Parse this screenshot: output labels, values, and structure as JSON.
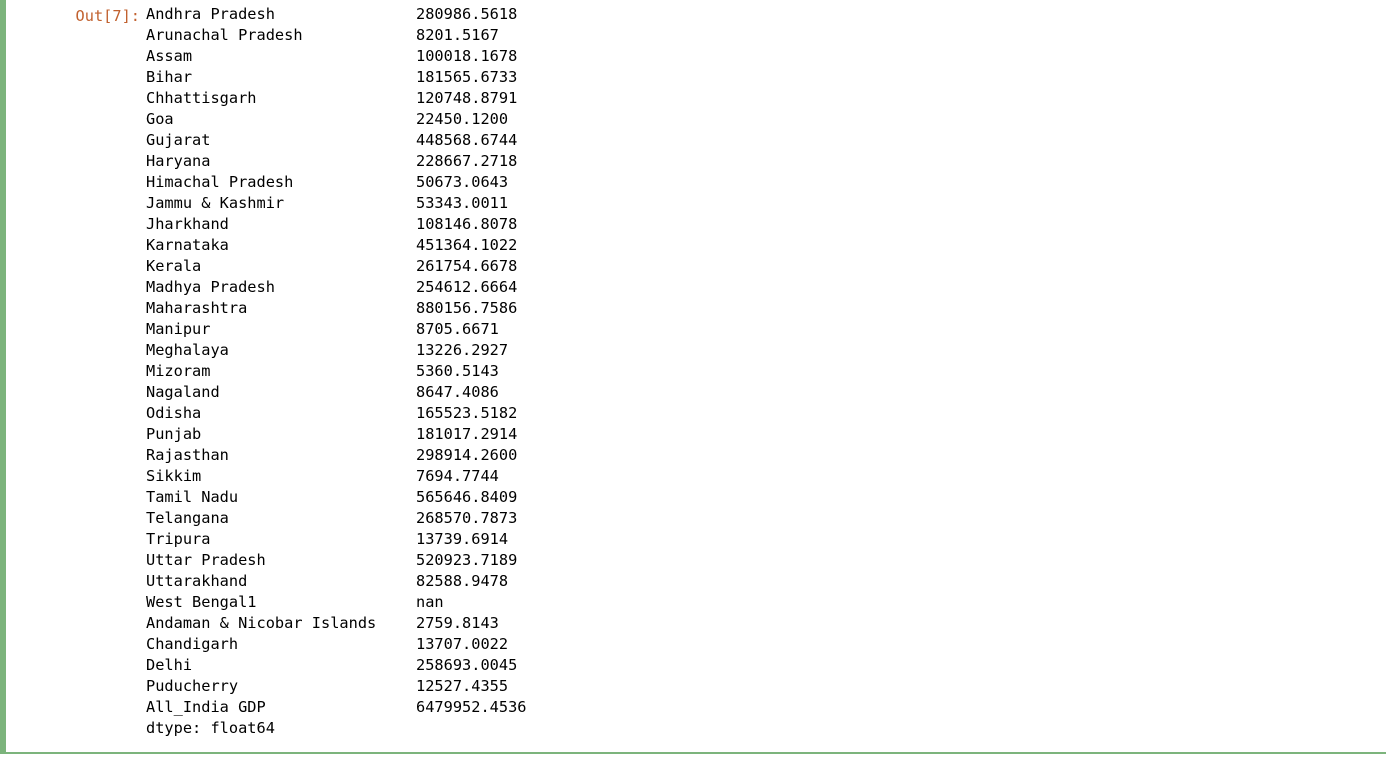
{
  "prompt": "Out[7]:",
  "rows": [
    {
      "name": "Andhra Pradesh",
      "value": "280986.5618"
    },
    {
      "name": "Arunachal Pradesh",
      "value": "8201.5167"
    },
    {
      "name": "Assam",
      "value": "100018.1678"
    },
    {
      "name": "Bihar",
      "value": "181565.6733"
    },
    {
      "name": "Chhattisgarh",
      "value": "120748.8791"
    },
    {
      "name": "Goa",
      "value": "22450.1200"
    },
    {
      "name": "Gujarat",
      "value": "448568.6744"
    },
    {
      "name": "Haryana",
      "value": "228667.2718"
    },
    {
      "name": "Himachal Pradesh",
      "value": "50673.0643"
    },
    {
      "name": "Jammu & Kashmir",
      "value": "53343.0011"
    },
    {
      "name": "Jharkhand",
      "value": "108146.8078"
    },
    {
      "name": "Karnataka",
      "value": "451364.1022"
    },
    {
      "name": "Kerala",
      "value": "261754.6678"
    },
    {
      "name": "Madhya Pradesh",
      "value": "254612.6664"
    },
    {
      "name": "Maharashtra",
      "value": "880156.7586"
    },
    {
      "name": "Manipur",
      "value": "8705.6671"
    },
    {
      "name": "Meghalaya",
      "value": "13226.2927"
    },
    {
      "name": "Mizoram",
      "value": "5360.5143"
    },
    {
      "name": "Nagaland",
      "value": "8647.4086"
    },
    {
      "name": "Odisha",
      "value": "165523.5182"
    },
    {
      "name": "Punjab",
      "value": "181017.2914"
    },
    {
      "name": "Rajasthan",
      "value": "298914.2600"
    },
    {
      "name": "Sikkim",
      "value": "7694.7744"
    },
    {
      "name": "Tamil Nadu",
      "value": "565646.8409"
    },
    {
      "name": "Telangana",
      "value": "268570.7873"
    },
    {
      "name": "Tripura",
      "value": "13739.6914"
    },
    {
      "name": "Uttar Pradesh",
      "value": "520923.7189"
    },
    {
      "name": "Uttarakhand",
      "value": "82588.9478"
    },
    {
      "name": "West Bengal1",
      "value": "nan"
    },
    {
      "name": "Andaman & Nicobar Islands",
      "value": "2759.8143"
    },
    {
      "name": "Chandigarh",
      "value": "13707.0022"
    },
    {
      "name": "Delhi",
      "value": "258693.0045"
    },
    {
      "name": "Puducherry",
      "value": "12527.4355"
    },
    {
      "name": "All_India GDP",
      "value": "6479952.4536"
    }
  ],
  "dtype": "dtype: float64"
}
